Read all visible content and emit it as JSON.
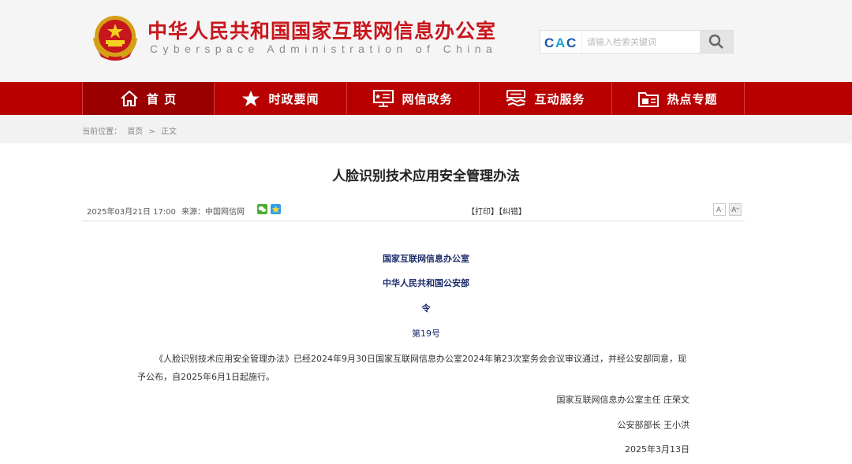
{
  "header": {
    "title_cn": "中华人民共和国国家互联网信息办公室",
    "title_en": "Cyberspace Administration of China",
    "search": {
      "logo": "CAC",
      "placeholder": "请输入检索关键词",
      "icon": "search-icon"
    }
  },
  "nav": {
    "items": [
      {
        "label": "首 页",
        "icon": "home-icon"
      },
      {
        "label": "时政要闻",
        "icon": "star-icon"
      },
      {
        "label": "网信政务",
        "icon": "monitor-icon"
      },
      {
        "label": "互动服务",
        "icon": "handshake-icon"
      },
      {
        "label": "热点专题",
        "icon": "folder-icon"
      }
    ]
  },
  "breadcrumb": {
    "prefix": "当前位置：",
    "home": "首页",
    "sep": ">",
    "current": "正文"
  },
  "article": {
    "title": "人脸识别技术应用安全管理办法",
    "date": "2025年03月21日  17:00",
    "source_label": "来源：",
    "source": "中国网信网",
    "actions": "【打印】【纠错】",
    "font_small": "A",
    "font_large": "A",
    "issuer1": "国家互联网信息办公室",
    "issuer2": "中华人民共和国公安部",
    "order": "令",
    "number": "第19号",
    "body": "《人脸识别技术应用安全管理办法》已经2024年9月30日国家互联网信息办公室2024年第23次室务会会议审议通过，并经公安部同意，现予公布，自2025年6月1日起施行。",
    "sign1": "国家互联网信息办公室主任 庄荣文",
    "sign2": "公安部部长 王小洪",
    "sign_date": "2025年3月13日"
  },
  "colors": {
    "brand_red": "#b80000",
    "title_red": "#c8161d",
    "navy": "#1a2a6b"
  }
}
